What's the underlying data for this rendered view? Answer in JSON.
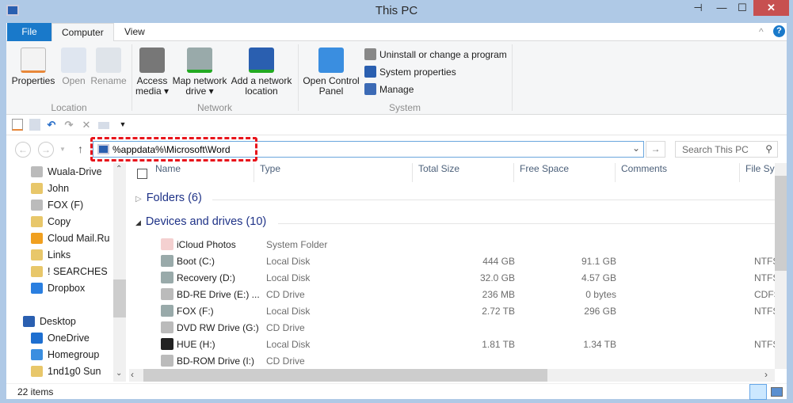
{
  "window": {
    "title": "This PC",
    "pin": "⊣",
    "minimize": "—",
    "maximize": "☐",
    "close": "✕"
  },
  "tabs": {
    "file": "File",
    "computer": "Computer",
    "view": "View",
    "collapse": "^",
    "help": "?"
  },
  "ribbon": {
    "location": {
      "label": "Location",
      "properties": "Properties",
      "open": "Open",
      "rename": "Rename"
    },
    "network": {
      "label": "Network",
      "access_media": [
        "Access",
        "media ▾"
      ],
      "map_drive": [
        "Map network",
        "drive ▾"
      ],
      "add_location": [
        "Add a network",
        "location"
      ]
    },
    "system": {
      "label": "System",
      "open_cp": [
        "Open Control",
        "Panel"
      ],
      "uninstall": "Uninstall or change a program",
      "sysprops": "System properties",
      "manage": "Manage"
    }
  },
  "address": {
    "value": "%appdata%\\Microsoft\\Word",
    "search_placeholder": "Search This PC",
    "back": "←",
    "forward": "→",
    "up": "↑",
    "go": "→",
    "dropdown": "⌄"
  },
  "sidebar": {
    "items": [
      "Wuala-Drive",
      "John",
      "FOX (F)",
      "Copy",
      "Cloud Mail.Ru",
      "Links",
      "! SEARCHES",
      "Dropbox"
    ],
    "items2": [
      "Desktop",
      "OneDrive",
      "Homegroup",
      "1nd1g0 Sun"
    ]
  },
  "columns": [
    "Name",
    "Type",
    "Total Size",
    "Free Space",
    "Comments",
    "File Sy"
  ],
  "groups": {
    "folders": "Folders (6)",
    "devices": "Devices and drives (10)"
  },
  "rows": [
    {
      "name": "iCloud Photos",
      "type": "System Folder",
      "total": "",
      "free": "",
      "fs": ""
    },
    {
      "name": "Boot (C:)",
      "type": "Local Disk",
      "total": "444 GB",
      "free": "91.1 GB",
      "fs": "NTFS"
    },
    {
      "name": "Recovery (D:)",
      "type": "Local Disk",
      "total": "32.0 GB",
      "free": "4.57 GB",
      "fs": "NTFS"
    },
    {
      "name": "BD-RE Drive (E:) ...",
      "type": "CD Drive",
      "total": "236 MB",
      "free": "0 bytes",
      "fs": "CDFS"
    },
    {
      "name": "FOX (F:)",
      "type": "Local Disk",
      "total": "2.72 TB",
      "free": "296 GB",
      "fs": "NTFS"
    },
    {
      "name": "DVD RW Drive (G:)",
      "type": "CD Drive",
      "total": "",
      "free": "",
      "fs": ""
    },
    {
      "name": "HUE (H:)",
      "type": "Local Disk",
      "total": "1.81 TB",
      "free": "1.34 TB",
      "fs": "NTFS"
    },
    {
      "name": "BD-ROM Drive (I:)",
      "type": "CD Drive",
      "total": "",
      "free": "",
      "fs": ""
    }
  ],
  "status": {
    "items": "22 items"
  }
}
